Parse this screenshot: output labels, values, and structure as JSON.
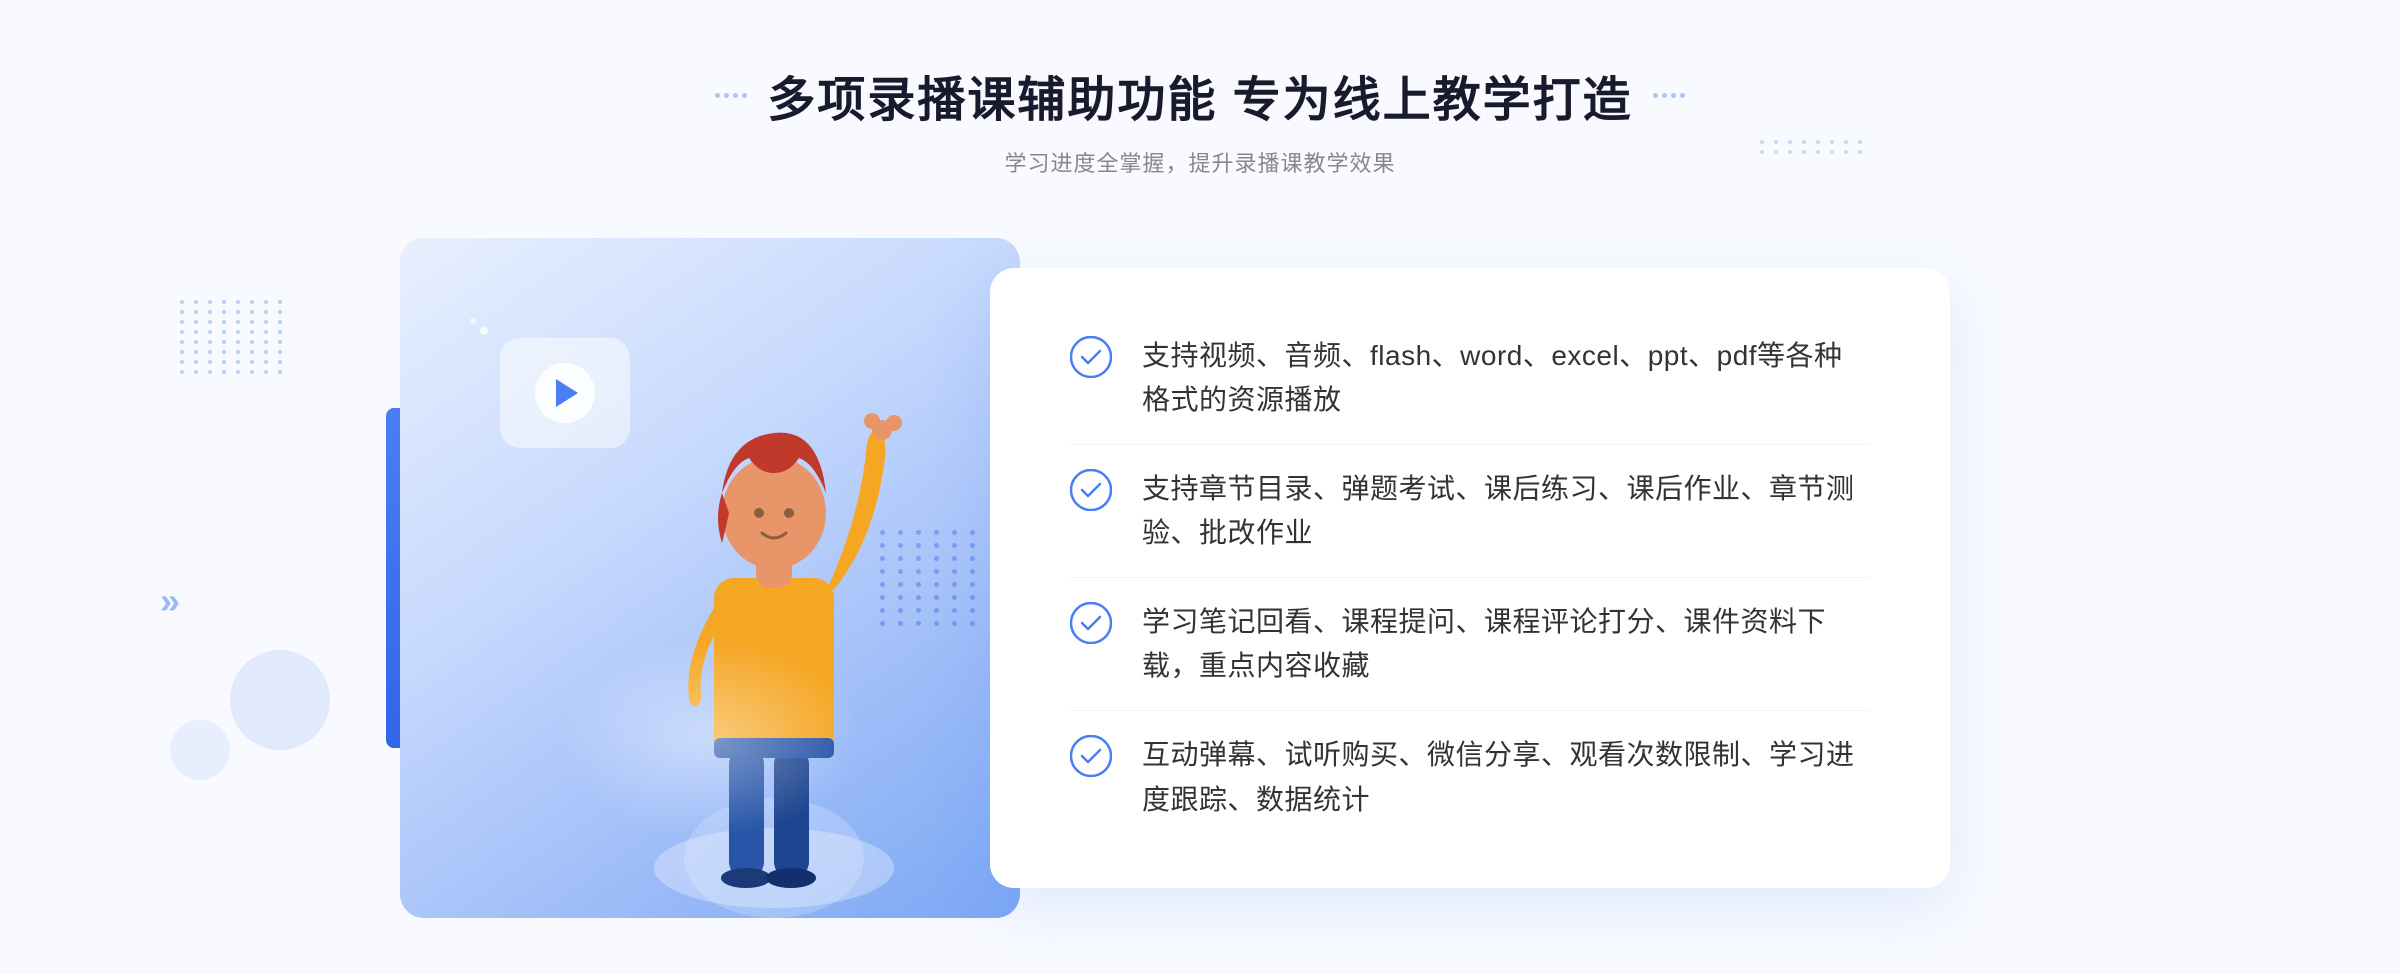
{
  "page": {
    "background": "#f8faff",
    "title": "多项录播课辅助功能 专为线上教学打造",
    "subtitle": "学习进度全掌握，提升录播课教学效果",
    "features": [
      {
        "id": 1,
        "text": "支持视频、音频、flash、word、excel、ppt、pdf等各种格式的资源播放"
      },
      {
        "id": 2,
        "text": "支持章节目录、弹题考试、课后练习、课后作业、章节测验、批改作业"
      },
      {
        "id": 3,
        "text": "学习笔记回看、课程提问、课程评论打分、课件资料下载，重点内容收藏"
      },
      {
        "id": 4,
        "text": "互动弹幕、试听购买、微信分享、观看次数限制、学习进度跟踪、数据统计"
      }
    ],
    "decorations": {
      "chevron": "»",
      "header_dots_left": "⁞⁞",
      "header_dots_right": "⁞⁞"
    }
  }
}
